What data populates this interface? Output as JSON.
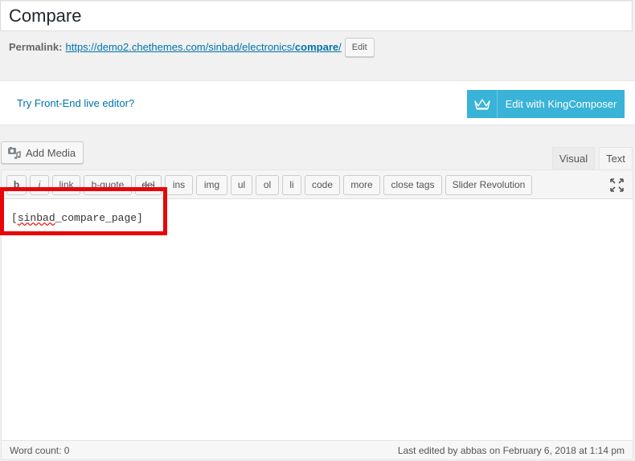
{
  "title": {
    "value": "Compare"
  },
  "permalink": {
    "label": "Permalink:",
    "url_base": "https://demo2.chethemes.com/sinbad/electronics/",
    "url_slug": "compare",
    "url_tail": "/",
    "edit_label": "Edit"
  },
  "kingcomposer": {
    "try_link": "Try Front-End live editor?",
    "button_label": "Edit with KingComposer",
    "accent_color": "#39b3d7"
  },
  "media": {
    "add_media_label": "Add Media",
    "icon": "camera-music-icon"
  },
  "tabs": {
    "visual": "Visual",
    "text": "Text",
    "active": "Text"
  },
  "quicktags": [
    {
      "label": "b"
    },
    {
      "label": "i"
    },
    {
      "label": "link"
    },
    {
      "label": "b-quote"
    },
    {
      "label": "del"
    },
    {
      "label": "ins"
    },
    {
      "label": "img"
    },
    {
      "label": "ul"
    },
    {
      "label": "ol"
    },
    {
      "label": "li"
    },
    {
      "label": "code"
    },
    {
      "label": "more"
    },
    {
      "label": "close tags"
    },
    {
      "label": "Slider Revolution"
    }
  ],
  "editor": {
    "content_open": "[",
    "content_word": "sinbad",
    "content_rest": "_compare_page]",
    "highlight_color": "#e8050a"
  },
  "status": {
    "word_count": "Word count: 0",
    "last_edited": "Last edited by abbas on February 6, 2018 at 1:14 pm"
  }
}
